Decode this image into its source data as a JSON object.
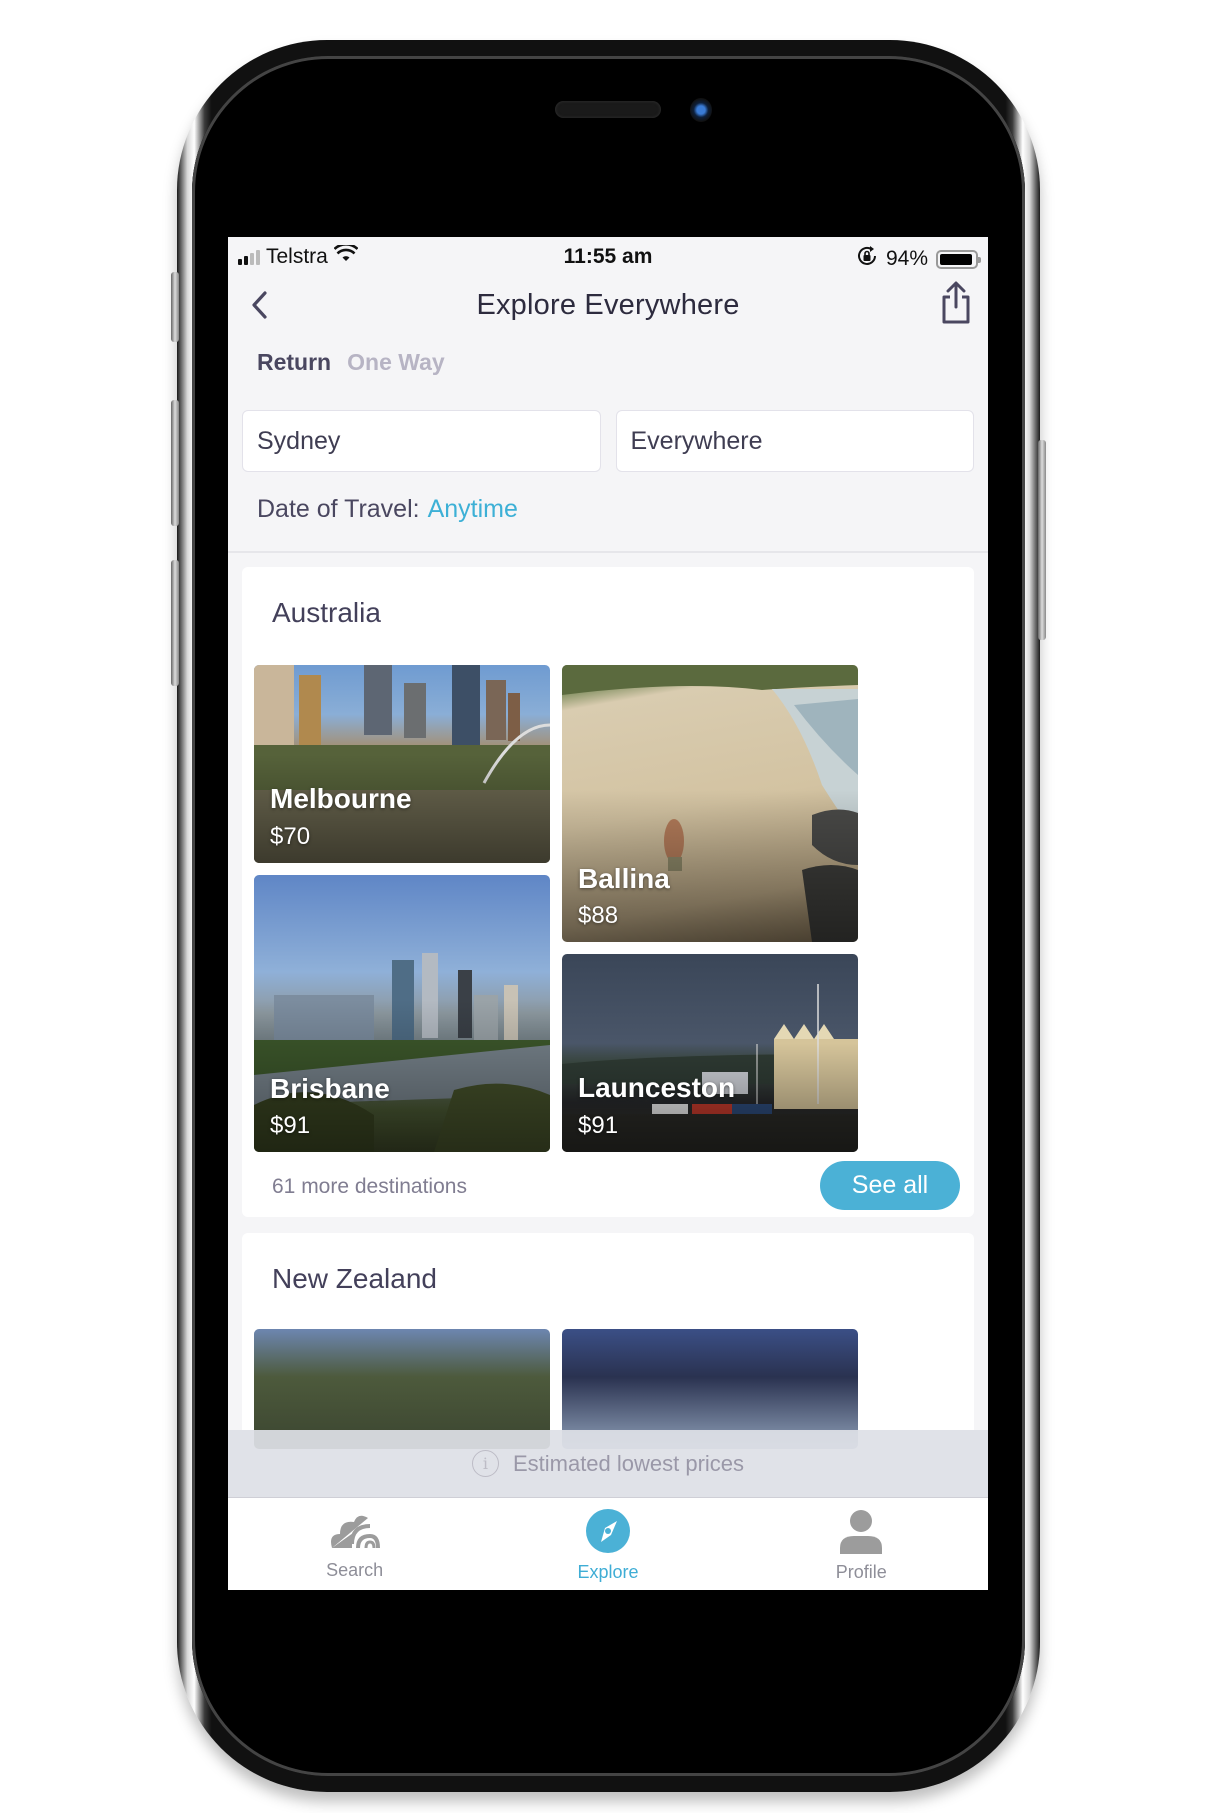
{
  "status_bar": {
    "carrier": "Telstra",
    "time": "11:55 am",
    "battery_percent_label": "94%",
    "battery_level": 0.94,
    "signal_bars_active": 2,
    "signal_bars_total": 4
  },
  "nav": {
    "title": "Explore Everywhere",
    "back_icon": "chevron-left-icon",
    "share_icon": "share-icon"
  },
  "trip_type": {
    "options": [
      {
        "label": "Return",
        "active": true
      },
      {
        "label": "One Way",
        "active": false
      }
    ]
  },
  "search": {
    "origin": "Sydney",
    "destination": "Everywhere"
  },
  "date_of_travel": {
    "label": "Date of Travel:",
    "value": "Anytime"
  },
  "sections": [
    {
      "title": "Australia",
      "destinations": [
        {
          "name": "Melbourne",
          "price": "$70"
        },
        {
          "name": "Ballina",
          "price": "$88"
        },
        {
          "name": "Brisbane",
          "price": "$91"
        },
        {
          "name": "Launceston",
          "price": "$91"
        }
      ],
      "more_text": "61 more destinations",
      "see_all_label": "See all"
    },
    {
      "title": "New Zealand",
      "destinations": []
    }
  ],
  "estimate_notice": {
    "icon": "info-icon",
    "text": "Estimated lowest prices"
  },
  "tab_bar": {
    "items": [
      {
        "label": "Search",
        "icon": "search-cloud-icon",
        "active": false
      },
      {
        "label": "Explore",
        "icon": "compass-icon",
        "active": true
      },
      {
        "label": "Profile",
        "icon": "person-icon",
        "active": false
      }
    ]
  },
  "colors": {
    "accent": "#4bb1d6",
    "title_text": "#2d2b3e",
    "inactive_tab": "#8e8e98"
  }
}
